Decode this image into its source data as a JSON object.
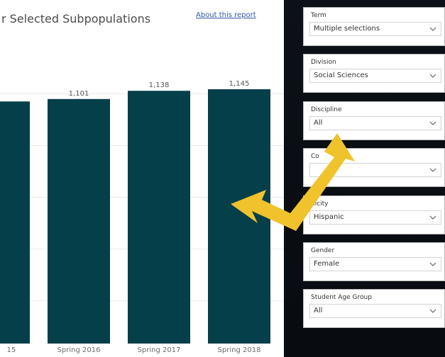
{
  "report": {
    "title": "r Selected Subpopulations",
    "about_link": "About this report"
  },
  "chart_data": {
    "type": "bar",
    "categories": [
      "15",
      "Spring 2016",
      "Spring 2017",
      "Spring 2018"
    ],
    "values": [
      1090,
      1101,
      1138,
      1145
    ],
    "data_labels": [
      "",
      "1,101",
      "1,138",
      "1,145"
    ],
    "title": "",
    "xlabel": "",
    "ylabel": "",
    "ylim": [
      0,
      1200
    ],
    "grid": true,
    "bar_color": "#053f4a"
  },
  "filters": [
    {
      "label": "Term",
      "value": "Multiple selections"
    },
    {
      "label": "Division",
      "value": "Social Sciences"
    },
    {
      "label": "Discipline",
      "value": "All"
    },
    {
      "label": "Co",
      "value": ""
    },
    {
      "label": "nicity",
      "value": "Hispanic"
    },
    {
      "label": "Gender",
      "value": "Female"
    },
    {
      "label": "Student Age Group",
      "value": "All"
    }
  ],
  "colors": {
    "arrow": "#f0c22c",
    "bars": "#053f4a",
    "link": "#2f56a6"
  }
}
